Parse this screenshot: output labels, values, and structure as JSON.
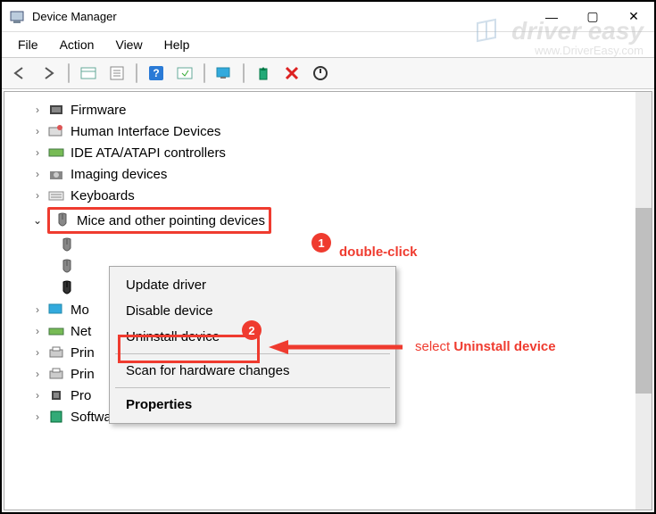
{
  "window": {
    "title": "Device Manager",
    "controls": {
      "min": "—",
      "max": "▢",
      "close": "✕"
    }
  },
  "menu": {
    "file": "File",
    "action": "Action",
    "view": "View",
    "help": "Help"
  },
  "toolbar": {
    "back": "back-icon",
    "forward": "forward-icon",
    "show_hidden": "show-hidden-icon",
    "properties": "properties-icon",
    "help": "help-icon",
    "monitor": "monitor-icon",
    "display": "display-icon",
    "update": "update-icon",
    "uninstall": "uninstall-icon",
    "rescan": "rescan-icon"
  },
  "tree": {
    "items": [
      {
        "label": "Firmware",
        "expandable": true
      },
      {
        "label": "Human Interface Devices",
        "expandable": true
      },
      {
        "label": "IDE ATA/ATAPI controllers",
        "expandable": true
      },
      {
        "label": "Imaging devices",
        "expandable": true
      },
      {
        "label": "Keyboards",
        "expandable": true
      },
      {
        "label": "Mice and other pointing devices",
        "expandable": true,
        "expanded": true,
        "children": [
          {
            "label": ""
          },
          {
            "label": ""
          },
          {
            "label": ""
          }
        ]
      },
      {
        "label": "Mo",
        "expandable": true
      },
      {
        "label": "Net",
        "expandable": true
      },
      {
        "label": "Prin",
        "expandable": true
      },
      {
        "label": "Prin",
        "expandable": true
      },
      {
        "label": "Pro",
        "expandable": true
      },
      {
        "label": "Software components",
        "expandable": true
      }
    ]
  },
  "context_menu": {
    "items": {
      "update": "Update driver",
      "disable": "Disable device",
      "uninstall": "Uninstall device",
      "scan": "Scan for hardware changes",
      "props": "Properties"
    }
  },
  "annotations": {
    "badge1": "1",
    "badge2": "2",
    "text1": "double-click",
    "text2": "select Uninstall device"
  },
  "watermark": {
    "brand": "driver easy",
    "url": "www.DriverEasy.com"
  }
}
